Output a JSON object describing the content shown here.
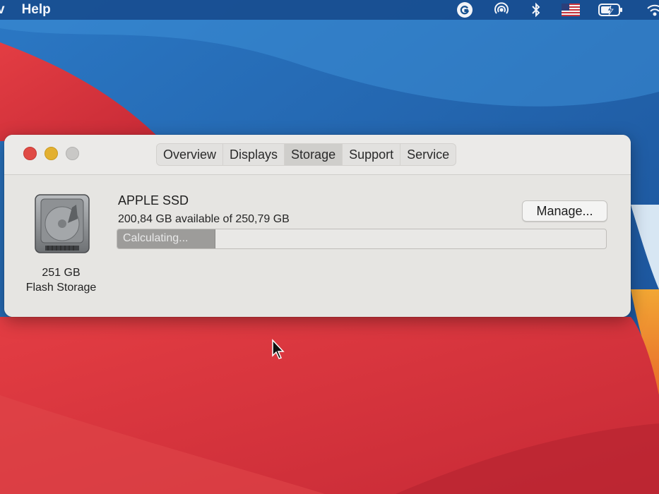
{
  "menubar": {
    "items": [
      "v",
      "Help"
    ],
    "status_icons": [
      "grammarly-icon",
      "airdrop-icon",
      "bluetooth-icon",
      "us-flag-input-icon",
      "battery-charging-icon",
      "wifi-icon"
    ]
  },
  "window": {
    "tabs": [
      {
        "label": "Overview",
        "active": false
      },
      {
        "label": "Displays",
        "active": false
      },
      {
        "label": "Storage",
        "active": true
      },
      {
        "label": "Support",
        "active": false
      },
      {
        "label": "Service",
        "active": false
      }
    ],
    "disk": {
      "size_label": "251 GB",
      "type_label": "Flash Storage"
    },
    "drive": {
      "name": "APPLE SSD",
      "available_text": "200,84 GB available of 250,79 GB",
      "progress_text": "Calculating...",
      "progress_fraction": 0.2
    },
    "manage_label": "Manage..."
  },
  "colors": {
    "close": "#e04a44",
    "minimize": "#e3b030",
    "zoom": "#c9c8c6",
    "wallpaper_blue": "#1c5fa8",
    "wallpaper_red": "#d8343c",
    "wallpaper_orange": "#e88a2a"
  }
}
